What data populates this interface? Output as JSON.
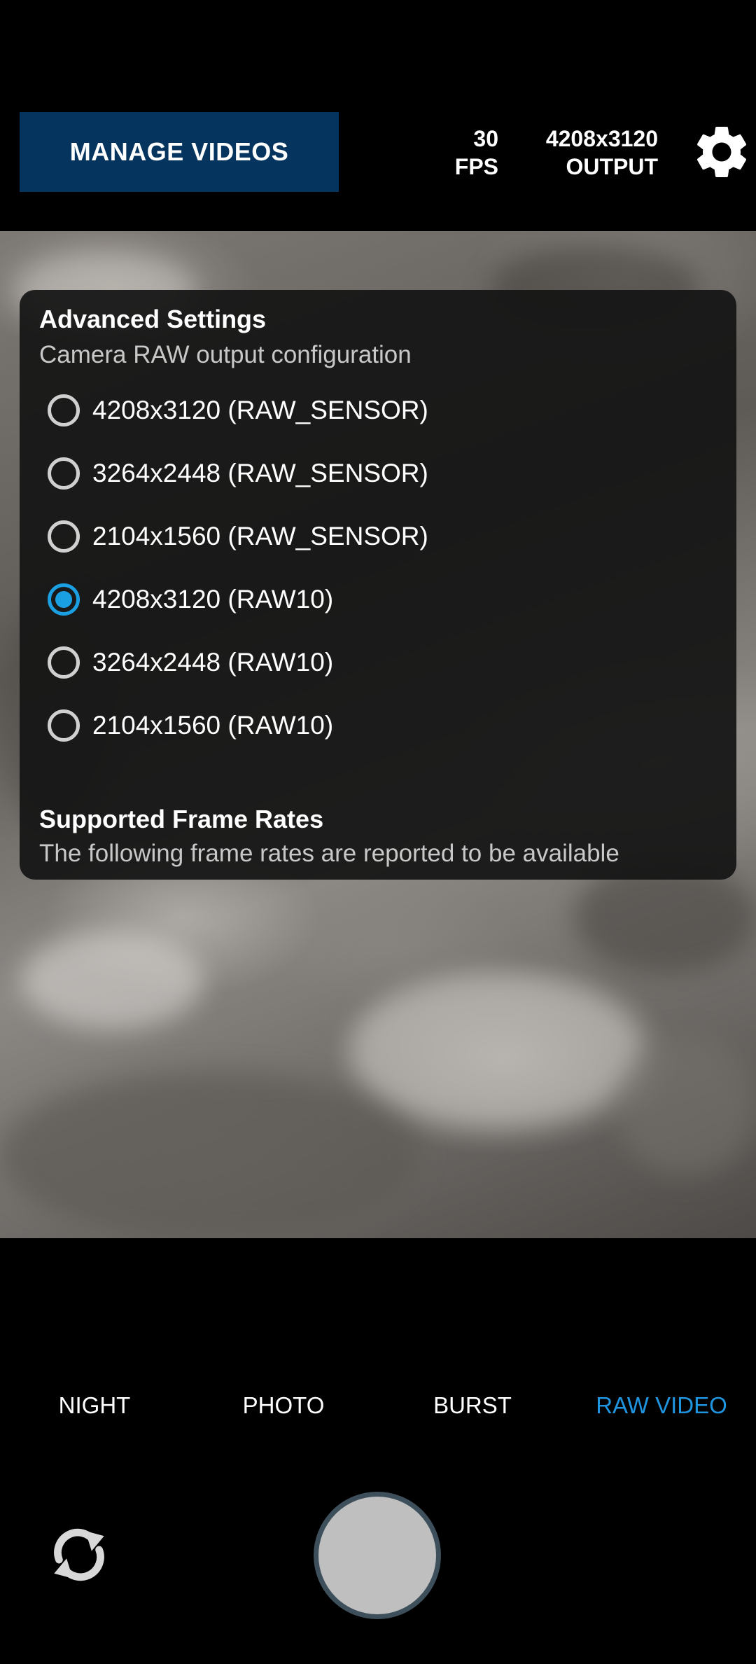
{
  "topbar": {
    "manage_videos_label": "MANAGE VIDEOS",
    "fps_value": "30",
    "fps_unit": "FPS",
    "output_value": "4208x3120",
    "output_unit": "OUTPUT",
    "settings_icon": "gear-icon"
  },
  "panel": {
    "title": "Advanced Settings",
    "subtitle": "Camera RAW output configuration",
    "options": [
      {
        "label": "4208x3120 (RAW_SENSOR)",
        "selected": false
      },
      {
        "label": "3264x2448 (RAW_SENSOR)",
        "selected": false
      },
      {
        "label": "2104x1560 (RAW_SENSOR)",
        "selected": false
      },
      {
        "label": "4208x3120 (RAW10)",
        "selected": true
      },
      {
        "label": "3264x2448 (RAW10)",
        "selected": false
      },
      {
        "label": "2104x1560 (RAW10)",
        "selected": false
      }
    ],
    "frame_rates_title": "Supported Frame Rates",
    "frame_rates_desc": "The following frame rates are reported to be available"
  },
  "modes": {
    "items": [
      {
        "label": "NIGHT",
        "active": false
      },
      {
        "label": "PHOTO",
        "active": false
      },
      {
        "label": "BURST",
        "active": false
      },
      {
        "label": "RAW VIDEO",
        "active": true
      }
    ]
  },
  "bottom": {
    "switch_camera_icon": "switch-camera-icon",
    "shutter_icon": "shutter-button"
  },
  "colors": {
    "accent": "#1a9fe3",
    "manage_button_bg": "#05355f",
    "panel_bg": "#141414"
  }
}
